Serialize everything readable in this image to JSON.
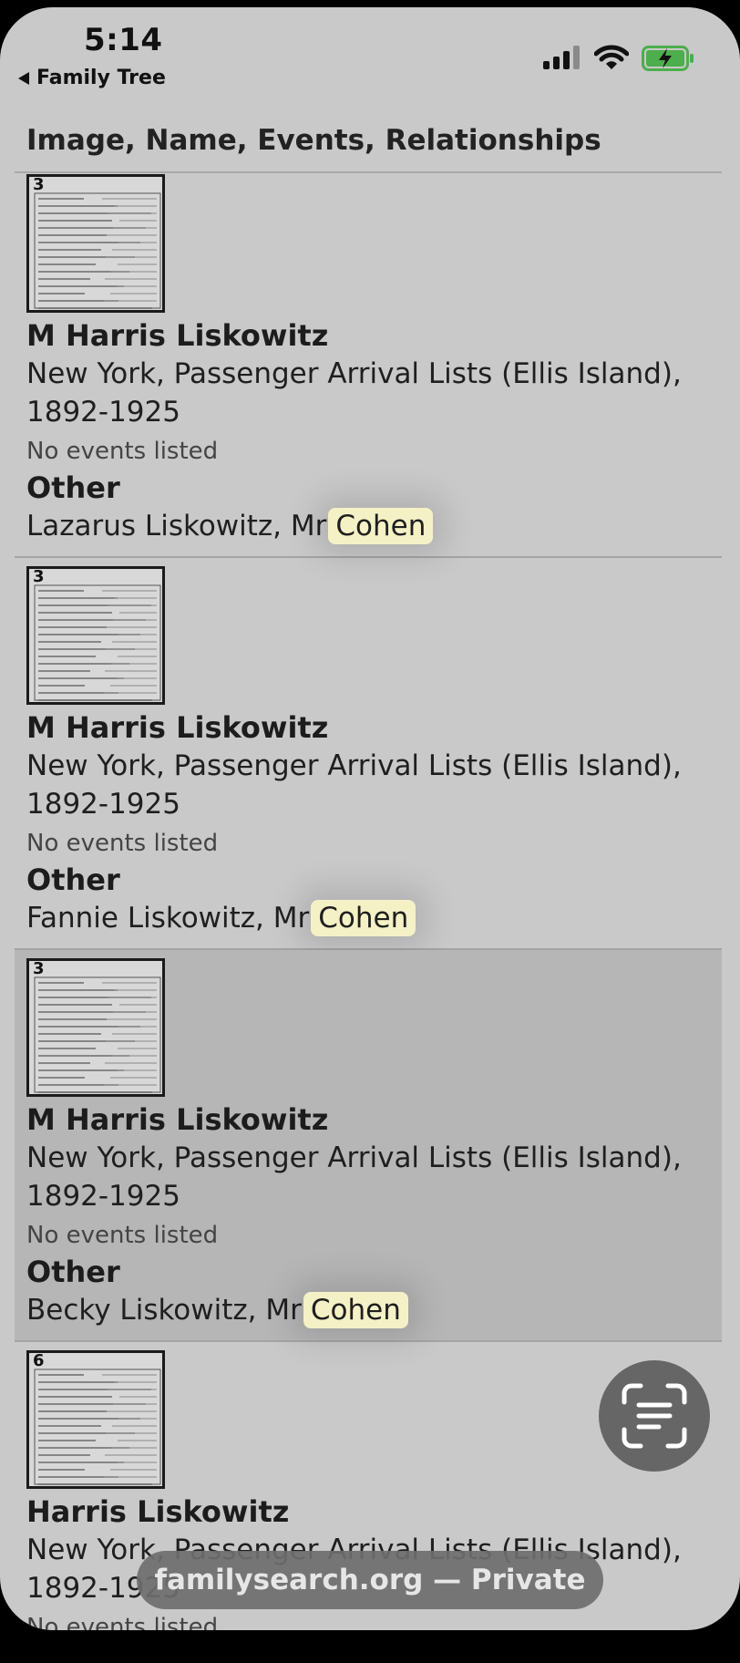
{
  "status_bar": {
    "time": "5:14",
    "back_label": "Family Tree"
  },
  "table": {
    "header": "Image, Name, Events, Relationships",
    "rows": [
      {
        "image_number": "3",
        "name": "M Harris Liskowitz",
        "collection": "New York, Passenger Arrival Lists (Ellis Island), 1892-1925",
        "events": "No events listed",
        "relationship_type": "Other",
        "relations_prefix": "Lazarus Liskowitz, Mr",
        "relations_highlight": "Cohen",
        "selected": false
      },
      {
        "image_number": "3",
        "name": "M Harris Liskowitz",
        "collection": "New York, Passenger Arrival Lists (Ellis Island), 1892-1925",
        "events": "No events listed",
        "relationship_type": "Other",
        "relations_prefix": "Fannie Liskowitz, Mr",
        "relations_highlight": "Cohen",
        "selected": false
      },
      {
        "image_number": "3",
        "name": "M Harris Liskowitz",
        "collection": "New York, Passenger Arrival Lists (Ellis Island), 1892-1925",
        "events": "No events listed",
        "relationship_type": "Other",
        "relations_prefix": "Becky Liskowitz, Mr",
        "relations_highlight": "Cohen",
        "selected": true
      },
      {
        "image_number": "6",
        "name": "Harris Liskowitz",
        "collection": "New York, Passenger Arrival Lists (Ellis Island), 1892-1925",
        "events": "No events listed",
        "relationship_type": "",
        "relations_prefix": "",
        "relations_highlight": "",
        "selected": false
      }
    ]
  },
  "browser": {
    "url_label": "familysearch.org — Private"
  },
  "icons": {
    "live_text": "live-text-scan-icon",
    "back": "back-arrow-icon",
    "signal": "cellular-signal-icon",
    "wifi": "wifi-icon",
    "battery": "battery-charging-icon"
  },
  "colors": {
    "highlight": "#f5f1c6",
    "battery_fill": "#4cae4c"
  }
}
